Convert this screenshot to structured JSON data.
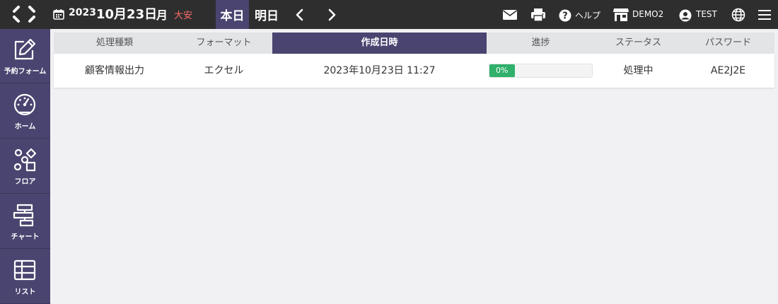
{
  "header": {
    "year": "2023",
    "month_day": "10月23日",
    "weekday": "月",
    "rokuyo": "大安",
    "today_label": "本日",
    "tomorrow_label": "明日",
    "help_label": "ヘルプ",
    "store_label": "DEMO2",
    "user_label": "TEST"
  },
  "sidebar": {
    "items": [
      {
        "label": "予約フォーム",
        "icon": "edit-icon"
      },
      {
        "label": "ホーム",
        "icon": "gauge-icon"
      },
      {
        "label": "フロア",
        "icon": "shapes-icon"
      },
      {
        "label": "チャート",
        "icon": "chart-icon"
      },
      {
        "label": "リスト",
        "icon": "table-icon"
      }
    ]
  },
  "table": {
    "columns": [
      "処理種類",
      "フォーマット",
      "作成日時",
      "進捗",
      "ステータス",
      "パスワード"
    ],
    "active_column": "作成日時",
    "rows": [
      {
        "type": "顧客情報出力",
        "format": "エクセル",
        "created": "2023年10月23日 11:27",
        "progress_label": "0%",
        "progress": 0,
        "status": "処理中",
        "password": "AE2J2E"
      }
    ]
  },
  "colors": {
    "topbar": "#2e2e2e",
    "accent": "#4a4470",
    "rokuyo": "#ff6b6b",
    "progress": "#2fb06b",
    "background": "#f1f1f3"
  }
}
